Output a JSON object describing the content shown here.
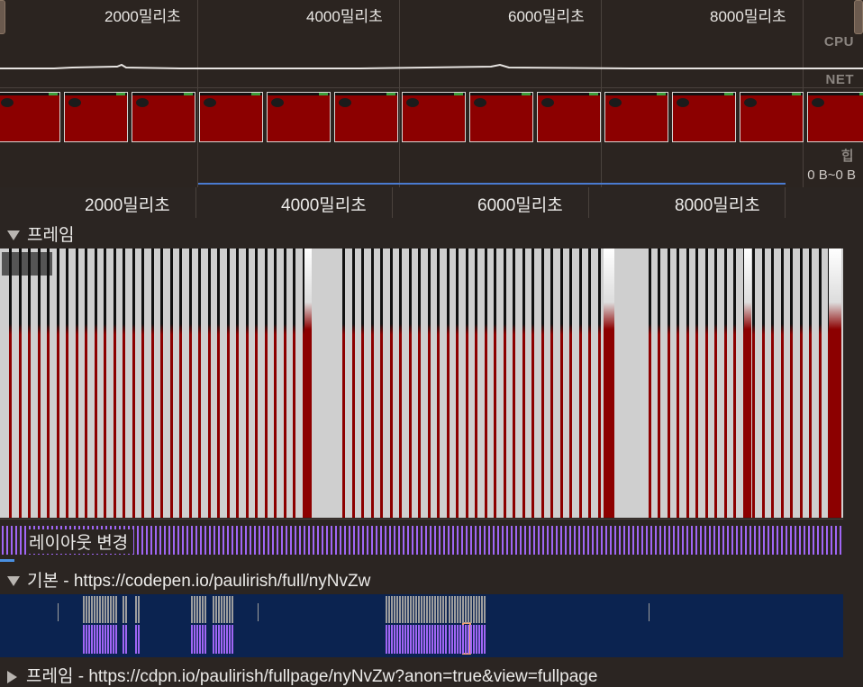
{
  "overview": {
    "time_labels": [
      "2000밀리초",
      "4000밀리초",
      "6000밀리초",
      "8000밀리초"
    ],
    "cpu_label": "CPU",
    "net_label": "NET",
    "heap_label": "힙",
    "heap_range": "0 B~0 B"
  },
  "ruler": {
    "time_labels": [
      "2000밀리초",
      "4000밀리초",
      "6000밀리초",
      "8000밀리초"
    ]
  },
  "tracks": {
    "frames_title": "프레임",
    "layout_shifts_title": "레이아웃 변경",
    "main_title": "기본 - https://codepen.io/paulirish/full/nyNvZw",
    "subframe_title": "프레임 - https://cdpn.io/paulirish/fullpage/nyNvZw?anon=true&view=fullpage"
  },
  "colors": {
    "background": "#2b2522",
    "frame_dropped": "#8c0000",
    "frame_idle": "#cfcfcf",
    "layout_shift": "#a066f5",
    "main_track": "#0b2350",
    "selection": "#f0a070"
  }
}
